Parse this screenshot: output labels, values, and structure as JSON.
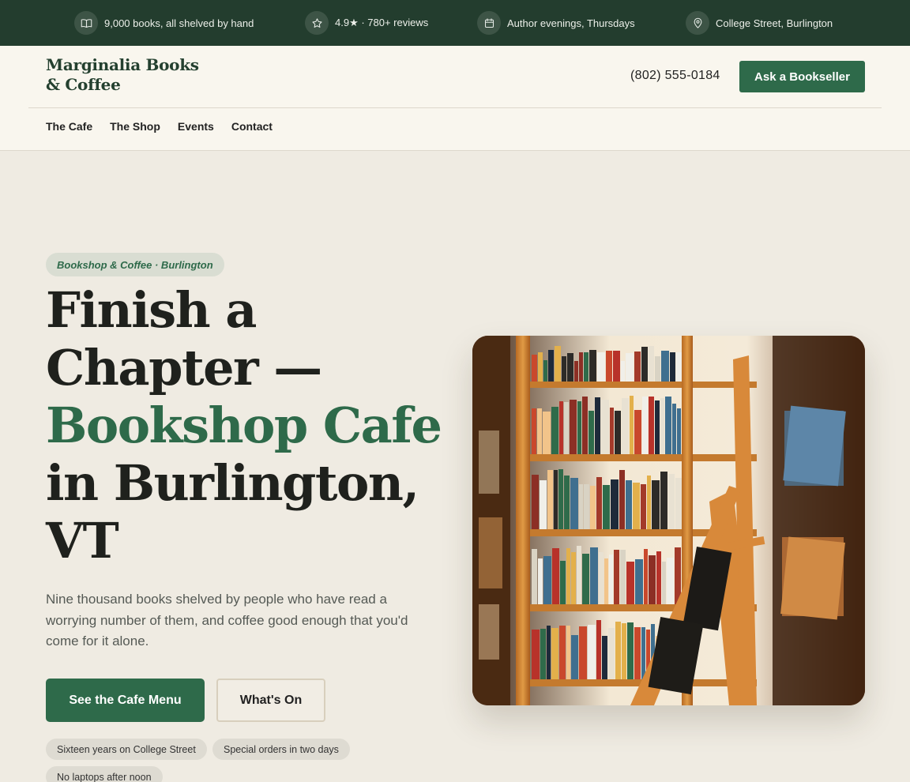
{
  "topbar": {
    "items": [
      {
        "icon": "book-icon",
        "text": "9,000 books, all shelved by hand"
      },
      {
        "icon": "star-icon",
        "text": "4.9★ · 780+ reviews"
      },
      {
        "icon": "calendar-icon",
        "text": "Author evenings, Thursdays"
      },
      {
        "icon": "location-pin-icon",
        "text": "College Street, Burlington"
      }
    ]
  },
  "header": {
    "logo_line1": "Marginalia Books",
    "logo_line2": "& Coffee",
    "phone": "(802) 555-0184",
    "cta_label": "Ask a Bookseller"
  },
  "nav": {
    "items": [
      "The Cafe",
      "The Shop",
      "Events",
      "Contact"
    ]
  },
  "hero": {
    "eyebrow": "Bookshop & Coffee · Burlington",
    "headline_line1": "Finish a",
    "headline_line2": "Chapter —",
    "headline_accent": "Bookshop Cafe",
    "headline_line4": "in Burlington,",
    "headline_line5": "VT",
    "lead": "Nine thousand books shelved by people who have read a worrying number of them, and coffee good enough that you'd come for it alone.",
    "primary_cta": "See the Cafe Menu",
    "secondary_cta": "What's On",
    "chips": [
      "Sixteen years on College Street",
      "Special orders in two days",
      "No laptops after noon"
    ]
  },
  "colors": {
    "topbar_bg": "#233d2e",
    "brand_green": "#2e6a4a",
    "page_bg": "#efebe2",
    "header_bg": "#f9f6ee"
  }
}
